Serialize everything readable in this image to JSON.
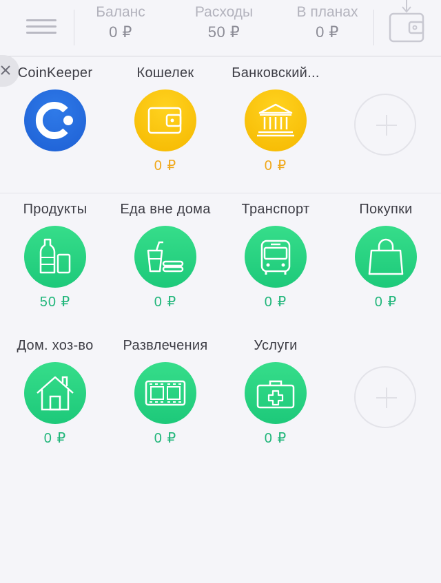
{
  "header": {
    "balance_label": "Баланс",
    "balance_value": "0 ₽",
    "expenses_label": "Расходы",
    "expenses_value": "50 ₽",
    "planned_label": "В планах",
    "planned_value": "0 ₽"
  },
  "accounts": [
    {
      "name": "CoinKeeper",
      "icon": "coinkeeper-logo",
      "amount": ""
    },
    {
      "name": "Кошелек",
      "icon": "wallet-icon",
      "amount": "0 ₽"
    },
    {
      "name": "Банковский...",
      "icon": "bank-icon",
      "amount": "0 ₽"
    }
  ],
  "expenses": [
    {
      "name": "Продукты",
      "icon": "bottle-glass-icon",
      "amount": "50 ₽"
    },
    {
      "name": "Еда вне дома",
      "icon": "fastfood-icon",
      "amount": "0 ₽"
    },
    {
      "name": "Транспорт",
      "icon": "bus-icon",
      "amount": "0 ₽"
    },
    {
      "name": "Покупки",
      "icon": "shopping-bag-icon",
      "amount": "0 ₽"
    },
    {
      "name": "Дом. хоз-во",
      "icon": "house-icon",
      "amount": "0 ₽"
    },
    {
      "name": "Развлечения",
      "icon": "film-icon",
      "amount": "0 ₽"
    },
    {
      "name": "Услуги",
      "icon": "medkit-icon",
      "amount": "0 ₽"
    }
  ],
  "colors": {
    "accent_green": "#20b67a",
    "account_yellow": "#f5b800",
    "coinkeeper_blue": "#1d5fd4",
    "background": "#f5f5f9"
  }
}
